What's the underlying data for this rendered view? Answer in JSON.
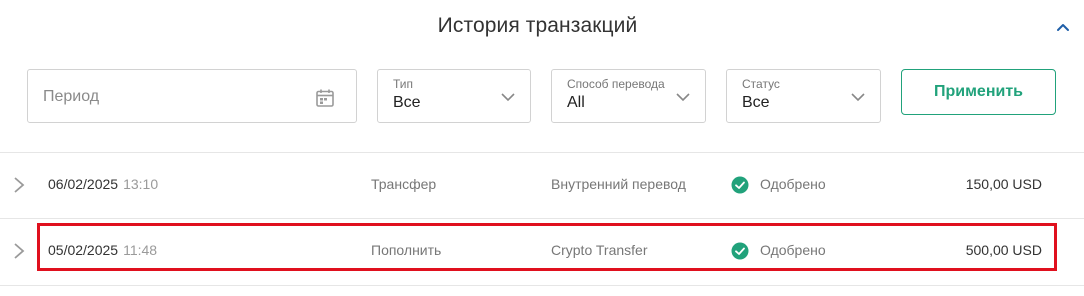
{
  "header": {
    "title": "История транзакций"
  },
  "filters": {
    "period": {
      "placeholder": "Период"
    },
    "type": {
      "label": "Тип",
      "value": "Все"
    },
    "method": {
      "label": "Способ перевода",
      "value": "All"
    },
    "status": {
      "label": "Статус",
      "value": "Все"
    },
    "apply_label": "Применить"
  },
  "transactions": [
    {
      "date": "06/02/2025",
      "time": "13:10",
      "type": "Трансфер",
      "method": "Внутренний перевод",
      "status": "Одобрено",
      "amount": "150,00 USD"
    },
    {
      "date": "05/02/2025",
      "time": "11:48",
      "type": "Пополнить",
      "method": "Crypto Transfer",
      "status": "Одобрено",
      "amount": "500,00 USD"
    }
  ],
  "colors": {
    "accent": "#21a27b",
    "status_approved": "#21a27b",
    "highlight": "#e0101e"
  }
}
